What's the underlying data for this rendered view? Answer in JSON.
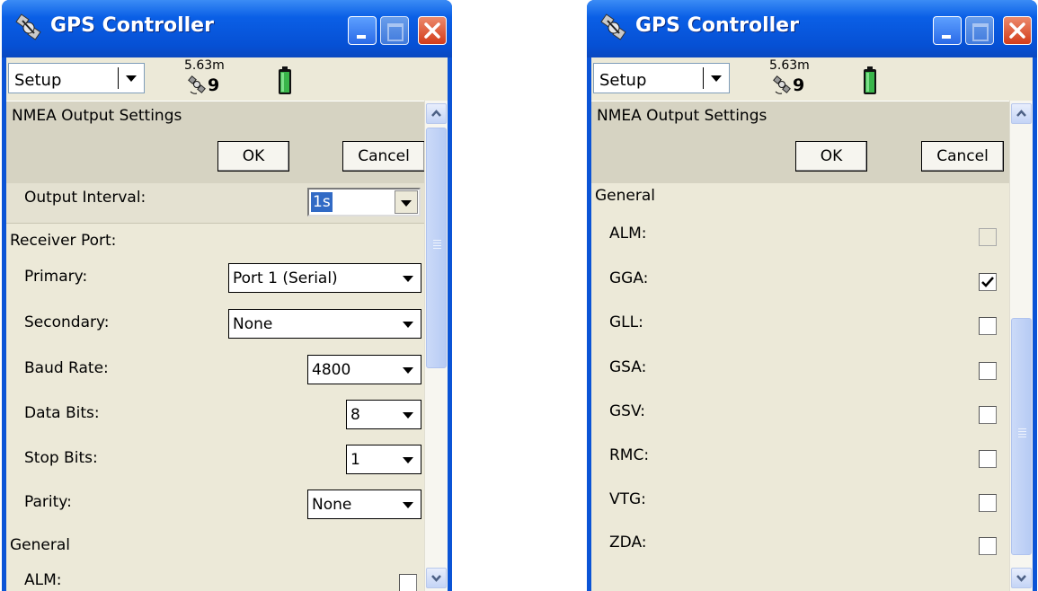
{
  "windows": [
    {
      "title": "GPS Controller",
      "toolbar": {
        "mode": "Setup",
        "accuracy": "5.63m",
        "satellites": "9"
      },
      "header": {
        "title": "NMEA Output Settings",
        "ok": "OK",
        "cancel": "Cancel"
      },
      "output_interval": {
        "label": "Output Interval:",
        "value": "1s"
      },
      "receiver_port": {
        "label": "Receiver Port:",
        "primary": {
          "label": "Primary:",
          "value": "Port 1 (Serial)"
        },
        "secondary": {
          "label": "Secondary:",
          "value": "None"
        },
        "baud_rate": {
          "label": "Baud Rate:",
          "value": "4800"
        },
        "data_bits": {
          "label": "Data Bits:",
          "value": "8"
        },
        "stop_bits": {
          "label": "Stop Bits:",
          "value": "1"
        },
        "parity": {
          "label": "Parity:",
          "value": "None"
        }
      },
      "general": {
        "label": "General",
        "items": [
          {
            "label": "ALM:",
            "checked": false
          }
        ]
      },
      "scrollbar": {
        "position": 0.0
      }
    },
    {
      "title": "GPS Controller",
      "toolbar": {
        "mode": "Setup",
        "accuracy": "5.63m",
        "satellites": "9"
      },
      "header": {
        "title": "NMEA Output Settings",
        "ok": "OK",
        "cancel": "Cancel"
      },
      "general": {
        "label": "General",
        "items": [
          {
            "label": "ALM:",
            "checked": false,
            "enabled": false
          },
          {
            "label": "GGA:",
            "checked": true,
            "enabled": true
          },
          {
            "label": "GLL:",
            "checked": false,
            "enabled": true
          },
          {
            "label": "GSA:",
            "checked": false,
            "enabled": true
          },
          {
            "label": "GSV:",
            "checked": false,
            "enabled": true
          },
          {
            "label": "RMC:",
            "checked": false,
            "enabled": true
          },
          {
            "label": "VTG:",
            "checked": false,
            "enabled": true
          },
          {
            "label": "ZDA:",
            "checked": false,
            "enabled": true
          }
        ]
      },
      "scrollbar": {
        "position": 1.0
      }
    }
  ],
  "colors": {
    "titlebar": "#0a5fe6",
    "client_bg": "#ece9d8",
    "header_bg": "#d6d3c2",
    "close_button": "#d33c1a",
    "selection": "#316ac5"
  },
  "icons": [
    "satellite-app-icon",
    "minimize-icon",
    "maximize-icon",
    "close-icon",
    "gps-satellite-icon",
    "battery-icon",
    "scroll-up-icon",
    "scroll-down-icon",
    "checkmark-icon"
  ]
}
